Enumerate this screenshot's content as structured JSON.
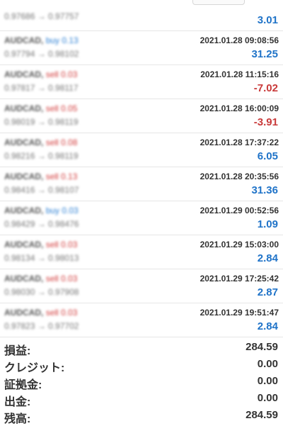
{
  "trades": [
    {
      "symbol": "",
      "side_label": "",
      "side": "",
      "price_text": "0.97686 → 0.97757",
      "time": "",
      "profit": "3.01",
      "sign": "pos"
    },
    {
      "symbol": "AUDCAD,",
      "side_label": "buy 0.13",
      "side": "buy",
      "price_text": "0.97794 → 0.98102",
      "time": "2021.01.28 09:08:56",
      "profit": "31.25",
      "sign": "pos"
    },
    {
      "symbol": "AUDCAD,",
      "side_label": "sell 0.03",
      "side": "sell",
      "price_text": "0.97817 → 0.98117",
      "time": "2021.01.28 11:15:16",
      "profit": "-7.02",
      "sign": "neg"
    },
    {
      "symbol": "AUDCAD,",
      "side_label": "sell 0.05",
      "side": "sell",
      "price_text": "0.98019 → 0.98119",
      "time": "2021.01.28 16:00:09",
      "profit": "-3.91",
      "sign": "neg"
    },
    {
      "symbol": "AUDCAD,",
      "side_label": "sell 0.08",
      "side": "sell",
      "price_text": "0.98216 → 0.98119",
      "time": "2021.01.28 17:37:22",
      "profit": "6.05",
      "sign": "pos"
    },
    {
      "symbol": "AUDCAD,",
      "side_label": "sell 0.13",
      "side": "sell",
      "price_text": "0.98416 → 0.98107",
      "time": "2021.01.28 20:35:56",
      "profit": "31.36",
      "sign": "pos"
    },
    {
      "symbol": "AUDCAD,",
      "side_label": "buy 0.03",
      "side": "buy",
      "price_text": "0.98429 → 0.98476",
      "time": "2021.01.29 00:52:56",
      "profit": "1.09",
      "sign": "pos"
    },
    {
      "symbol": "AUDCAD,",
      "side_label": "sell 0.03",
      "side": "sell",
      "price_text": "0.98134 → 0.98013",
      "time": "2021.01.29 15:03:00",
      "profit": "2.84",
      "sign": "pos"
    },
    {
      "symbol": "AUDCAD,",
      "side_label": "sell 0.03",
      "side": "sell",
      "price_text": "0.98030 → 0.97908",
      "time": "2021.01.29 17:25:42",
      "profit": "2.87",
      "sign": "pos"
    },
    {
      "symbol": "AUDCAD,",
      "side_label": "sell 0.03",
      "side": "sell",
      "price_text": "0.97823 → 0.97702",
      "time": "2021.01.29 19:51:47",
      "profit": "2.84",
      "sign": "pos"
    }
  ],
  "summary": {
    "profit_label": "損益:",
    "profit_value": "284.59",
    "credit_label": "クレジット:",
    "credit_value": "0.00",
    "deposit_label": "証拠金:",
    "deposit_value": "0.00",
    "withdrawal_label": "出金:",
    "withdrawal_value": "0.00",
    "balance_label": "残高:",
    "balance_value": "284.59"
  },
  "colors": {
    "profit_positive": "#1f73c8",
    "profit_negative": "#c93a3a",
    "buy": "#2a7fd4",
    "sell": "#d23a3a"
  }
}
